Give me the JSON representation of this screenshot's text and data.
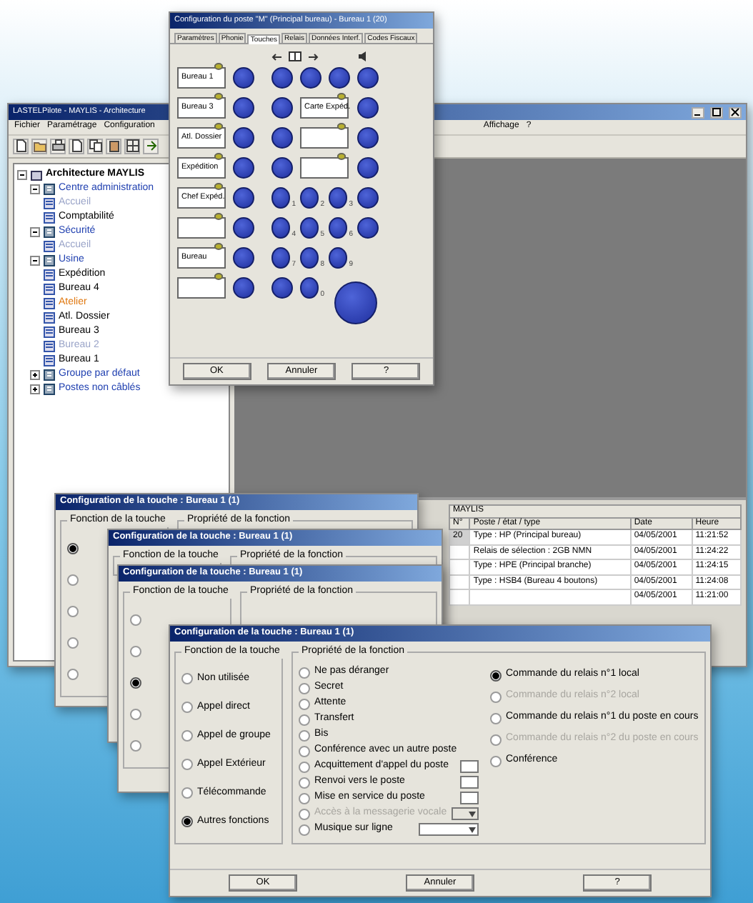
{
  "main_window": {
    "title": "LASTELPilote - MAYLIS - Architecture",
    "menu": [
      "Fichier",
      "Paramétrage",
      "Configuration",
      "Affichage",
      "?"
    ],
    "tree": [
      {
        "label": "Architecture MAYLIS",
        "kind": "root",
        "expanded": true,
        "children": [
          {
            "label": "Centre administration",
            "kind": "group",
            "expanded": true,
            "children": [
              {
                "label": "Accueil",
                "kind": "muted"
              },
              {
                "label": "Comptabilité",
                "kind": "normal"
              }
            ]
          },
          {
            "label": "Sécurité",
            "kind": "group",
            "expanded": true,
            "children": [
              {
                "label": "Accueil",
                "kind": "muted"
              }
            ]
          },
          {
            "label": "Usine",
            "kind": "group",
            "expanded": true,
            "children": [
              {
                "label": "Expédition",
                "kind": "normal"
              },
              {
                "label": "Bureau 4",
                "kind": "normal"
              },
              {
                "label": "Atelier",
                "kind": "alert"
              },
              {
                "label": "Atl. Dossier",
                "kind": "normal"
              },
              {
                "label": "Bureau 3",
                "kind": "normal"
              },
              {
                "label": "Bureau 2",
                "kind": "muted"
              },
              {
                "label": "Bureau 1",
                "kind": "normal"
              }
            ]
          },
          {
            "label": "Groupe par défaut",
            "kind": "group",
            "expanded": false
          },
          {
            "label": "Postes non câblés",
            "kind": "group",
            "expanded": false
          }
        ]
      }
    ],
    "table": {
      "group_header": "MAYLIS",
      "columns": [
        "N°",
        "Poste / état / type",
        "Date",
        "Heure"
      ],
      "rows": [
        [
          "20",
          "Type : HP (Principal bureau)",
          "04/05/2001",
          "11:21:52"
        ],
        [
          "",
          "Relais de sélection : 2GB NMN",
          "04/05/2001",
          "11:24:22"
        ],
        [
          "",
          "Type : HPE (Principal branche)",
          "04/05/2001",
          "11:24:15"
        ],
        [
          "",
          "Type : HSB4 (Bureau 4 boutons)",
          "04/05/2001",
          "11:24:08"
        ],
        [
          "",
          "",
          "04/05/2001",
          "11:21:00"
        ]
      ]
    }
  },
  "phone_dialog": {
    "title": "Configuration du poste \"M\" (Principal bureau) - Bureau 1 (20)",
    "tabs": [
      {
        "label": "Paramètres",
        "selected": false
      },
      {
        "label": "Phonie",
        "selected": false
      },
      {
        "label": "Touches",
        "selected": true
      },
      {
        "label": "Relais",
        "selected": false
      },
      {
        "label": "Données Interf.",
        "selected": false
      },
      {
        "label": "Codes Fiscaux",
        "selected": false
      }
    ],
    "line_keys": [
      {
        "label": "Bureau 1",
        "led": true
      },
      {
        "label": "Bureau 3",
        "led": true
      },
      {
        "label": "Atl. Dossier",
        "led": true
      },
      {
        "label": "Expédition",
        "led": true
      },
      {
        "label": "Chef Expéd.",
        "led": true
      },
      {
        "led": true
      },
      {
        "label": "Bureau",
        "led": true
      },
      {
        "led": true
      }
    ],
    "middle_keys": [
      {
        "label": "Carte Expéd.",
        "led": true
      },
      {
        "led": true
      },
      {
        "led": true
      }
    ],
    "keypad": [
      {
        "kind": "digit",
        "digit": "1"
      },
      {
        "kind": "digit",
        "digit": "2"
      },
      {
        "kind": "digit",
        "digit": "3"
      },
      {
        "kind": "digit",
        "digit": "4"
      },
      {
        "kind": "digit",
        "digit": "5"
      },
      {
        "kind": "digit",
        "digit": "6"
      },
      {
        "kind": "digit",
        "digit": "7"
      },
      {
        "kind": "digit",
        "digit": "8"
      },
      {
        "kind": "digit",
        "digit": "9"
      },
      {
        "kind": "plain"
      },
      {
        "kind": "digit",
        "digit": "0"
      }
    ],
    "buttons": [
      "OK",
      "Annuler",
      "?"
    ]
  },
  "key_dialogs": [
    {
      "title": "Configuration de la touche : Bureau 1 (1)",
      "function_group": "Fonction de la touche",
      "property_group": "Propriété de la fonction",
      "functions": [
        {
          "selected": true
        },
        {
          "selected": false
        },
        {
          "selected": false
        },
        {
          "selected": false
        },
        {
          "selected": false
        }
      ]
    },
    {
      "title": "Configuration de la touche : Bureau 1 (1)",
      "function_group": "Fonction de la touche",
      "property_group": "Propriété de la fonction"
    },
    {
      "title": "Configuration de la touche : Bureau 1 (1)",
      "function_group": "Fonction de la touche",
      "property_group": "Propriété de la fonction",
      "functions": [
        {
          "selected": false
        },
        {
          "selected": false
        },
        {
          "selected": true
        },
        {
          "selected": false
        },
        {
          "selected": false
        }
      ]
    }
  ],
  "front_dialog": {
    "title": "Configuration de la touche : Bureau 1 (1)",
    "function_group": "Fonction de la touche",
    "property_group": "Propriété de la fonction",
    "functions": [
      {
        "label": "Non utilisée",
        "selected": false
      },
      {
        "label": "Appel direct",
        "selected": false
      },
      {
        "label": "Appel de groupe",
        "selected": false
      },
      {
        "label": "Appel Extérieur",
        "selected": false
      },
      {
        "label": "Télécommande",
        "selected": false
      },
      {
        "label": "Autres fonctions",
        "selected": true
      }
    ],
    "properties_left": [
      {
        "label": "Ne pas déranger",
        "selected": false,
        "disabled": false,
        "kind": "plain"
      },
      {
        "label": "Secret",
        "selected": false,
        "disabled": false,
        "kind": "plain"
      },
      {
        "label": "Attente",
        "selected": false,
        "disabled": false,
        "kind": "plain"
      },
      {
        "label": "Transfert",
        "selected": false,
        "disabled": false,
        "kind": "plain"
      },
      {
        "label": "Bis",
        "selected": false,
        "disabled": false,
        "kind": "plain"
      },
      {
        "label": "Conférence avec un autre poste",
        "selected": false,
        "disabled": false,
        "kind": "plain"
      },
      {
        "label": "Acquittement d'appel du poste",
        "selected": false,
        "disabled": false,
        "kind": "box"
      },
      {
        "label": "Renvoi vers le poste",
        "selected": false,
        "disabled": false,
        "kind": "box"
      },
      {
        "label": "Mise en service du poste",
        "selected": false,
        "disabled": false,
        "kind": "box"
      },
      {
        "label": "Accès à la messagerie vocale",
        "selected": false,
        "disabled": true,
        "kind": "select"
      },
      {
        "label": "Musique sur ligne",
        "selected": false,
        "disabled": false,
        "kind": "select"
      }
    ],
    "properties_right": [
      {
        "label": "Commande du relais n°1 local",
        "selected": true,
        "disabled": false
      },
      {
        "label": "Commande du relais n°2 local",
        "selected": false,
        "disabled": true
      },
      {
        "label": "Commande du relais n°1 du poste en cours",
        "selected": false,
        "disabled": false
      },
      {
        "label": "Commande du relais n°2 du poste en cours",
        "selected": false,
        "disabled": true
      },
      {
        "label": "Conférence",
        "selected": false,
        "disabled": false
      }
    ],
    "buttons": [
      "OK",
      "Annuler",
      "?"
    ]
  }
}
